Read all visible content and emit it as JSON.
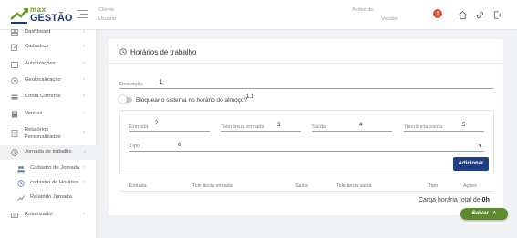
{
  "header": {
    "logo_max": "max",
    "logo_gestao": "GESTÃO",
    "cliente_label": "Cliente:",
    "usuario_label": "Usuário:",
    "ambiente_label": "Ambiente:",
    "versao_label": "Versão:",
    "notification_count": "0",
    "icons": [
      "menu-icon",
      "bell-icon",
      "home-icon",
      "link-icon",
      "logout-icon"
    ]
  },
  "sidebar": {
    "items": [
      {
        "label": "Dashboard",
        "icon": "dashboard-icon"
      },
      {
        "label": "Cadastros",
        "icon": "edit-icon"
      },
      {
        "label": "Autorizações",
        "icon": "calendar-icon"
      },
      {
        "label": "Geolocalização",
        "icon": "location-icon"
      },
      {
        "label": "Conta Corrente",
        "icon": "card-icon"
      },
      {
        "label": "Vendas",
        "icon": "book-icon"
      },
      {
        "label": "Relatórios",
        "label2": "Personalizados",
        "icon": "report-icon"
      },
      {
        "label": "Jornada de trabalho",
        "icon": "clock-icon"
      },
      {
        "label": "Cadastro de Jornada",
        "icon": "group-icon"
      },
      {
        "label": "cadastro de Horários",
        "icon": "clock-icon"
      },
      {
        "label": "Relatório Jornada",
        "icon": "chart-icon"
      },
      {
        "label": "Roteirizador",
        "icon": "route-icon"
      }
    ],
    "chevron": "›"
  },
  "card": {
    "title": "Horários de trabalho",
    "descricao_label": "Descrição",
    "descricao_value": "1",
    "toggle_label": "Bloquear o sistema no horário do almoço?",
    "toggle_marker": "1.1",
    "entrada_label": "Entrada",
    "entrada_value": "2",
    "tol_entrada_label": "Tolerância entrada",
    "tol_entrada_value": "3",
    "saida_label": "Saída",
    "saida_value": "4",
    "tol_saida_label": "Tolerância saída",
    "tol_saida_value": "5",
    "tipo_label": "Tipo",
    "tipo_value": "6",
    "add_button": "Adicionar",
    "table_headers": [
      "Entrada",
      "Tolerância entrada",
      "Saída",
      "Tolerância saída",
      "Tipo",
      "Ações"
    ],
    "total_label": "Carga horária total de",
    "total_value": "0h"
  },
  "save_button": "Salvar",
  "colors": {
    "primary": "#1f3e86",
    "success": "#5e8a2e",
    "badge": "#d64b3c",
    "logo_green": "#6a9f2b",
    "logo_blue": "#1e3a74"
  }
}
